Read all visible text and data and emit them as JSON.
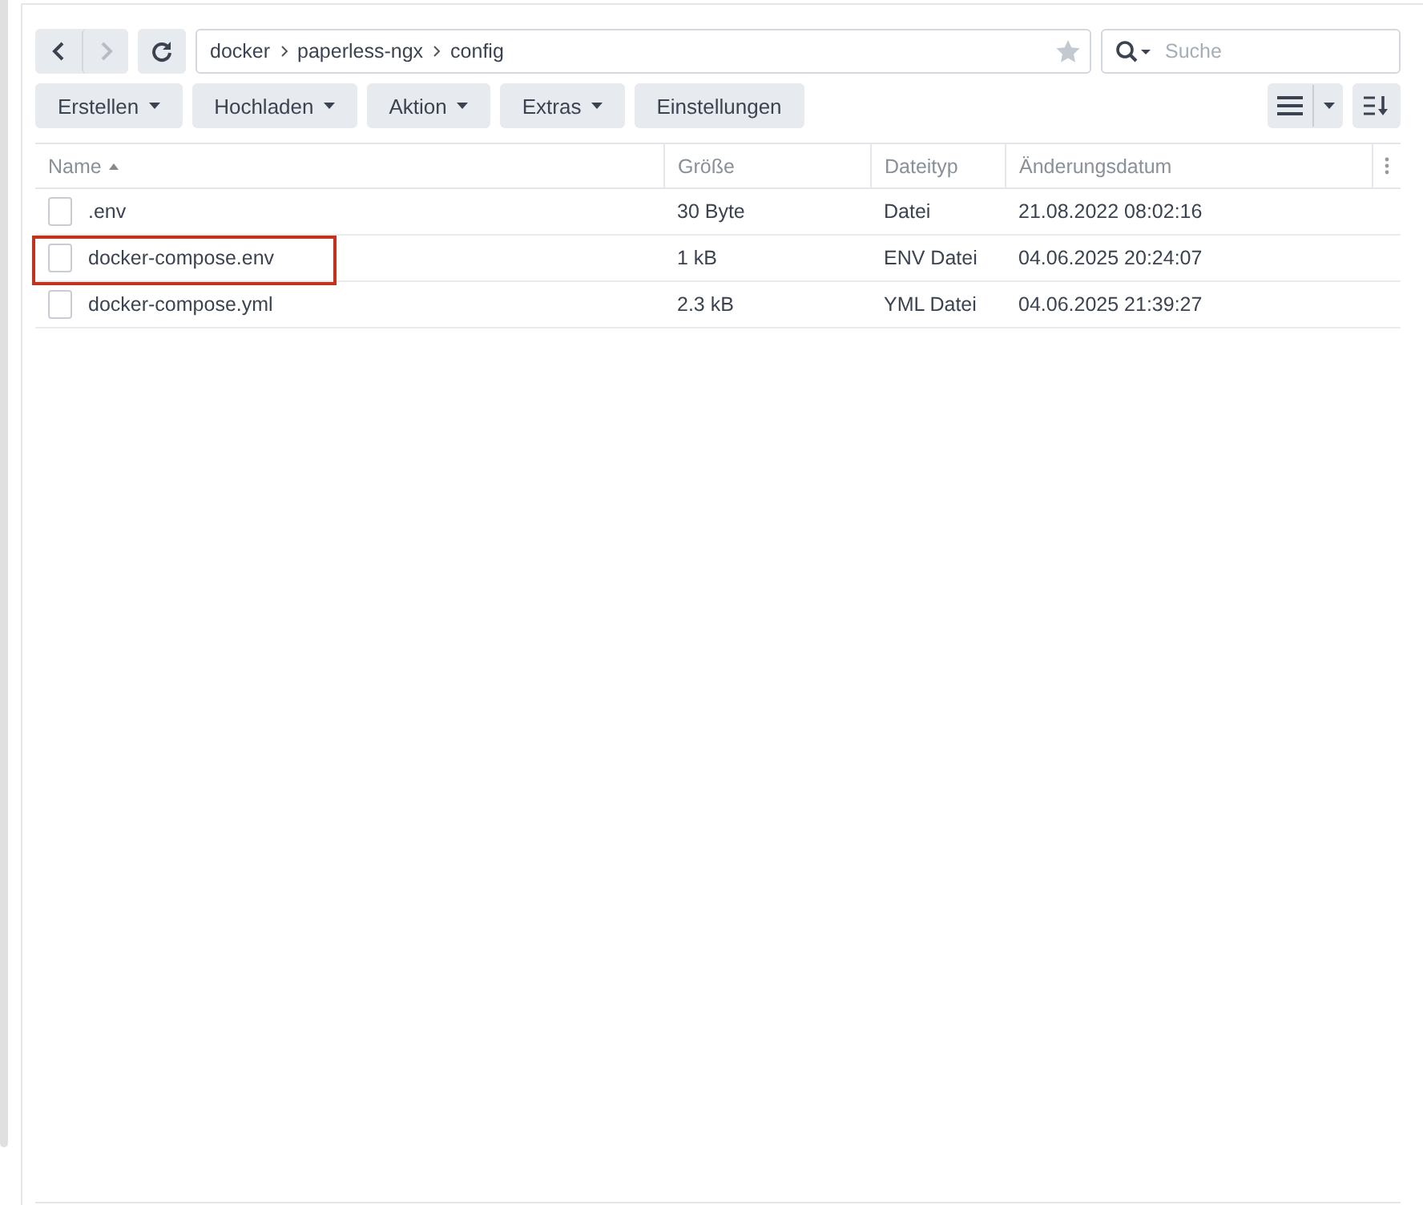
{
  "navigation": {
    "back_disabled": false,
    "forward_disabled": true
  },
  "path": [
    "docker",
    "paperless-ngx",
    "config"
  ],
  "favorite": {
    "on": false
  },
  "search": {
    "placeholder": "Suche"
  },
  "toolbar": [
    {
      "label": "Erstellen",
      "dropdown": true
    },
    {
      "label": "Hochladen",
      "dropdown": true
    },
    {
      "label": "Aktion",
      "dropdown": true
    },
    {
      "label": "Extras",
      "dropdown": true
    },
    {
      "label": "Einstellungen",
      "dropdown": false
    }
  ],
  "table": {
    "columns": [
      {
        "label": "Name",
        "sorted": true
      },
      {
        "label": "Größe",
        "sorted": false
      },
      {
        "label": "Dateityp",
        "sorted": false
      },
      {
        "label": "Änderungsdatum",
        "sorted": false
      }
    ],
    "rows": [
      {
        "name": ".env",
        "size": "30 Byte",
        "type": "Datei",
        "modified": "21.08.2022 08:02:16",
        "highlighted": false
      },
      {
        "name": "docker-compose.env",
        "size": "1 kB",
        "type": "ENV Datei",
        "modified": "04.06.2025 20:24:07",
        "highlighted": true
      },
      {
        "name": "docker-compose.yml",
        "size": "2.3 kB",
        "type": "YML Datei",
        "modified": "04.06.2025 21:39:27",
        "highlighted": false
      }
    ]
  }
}
